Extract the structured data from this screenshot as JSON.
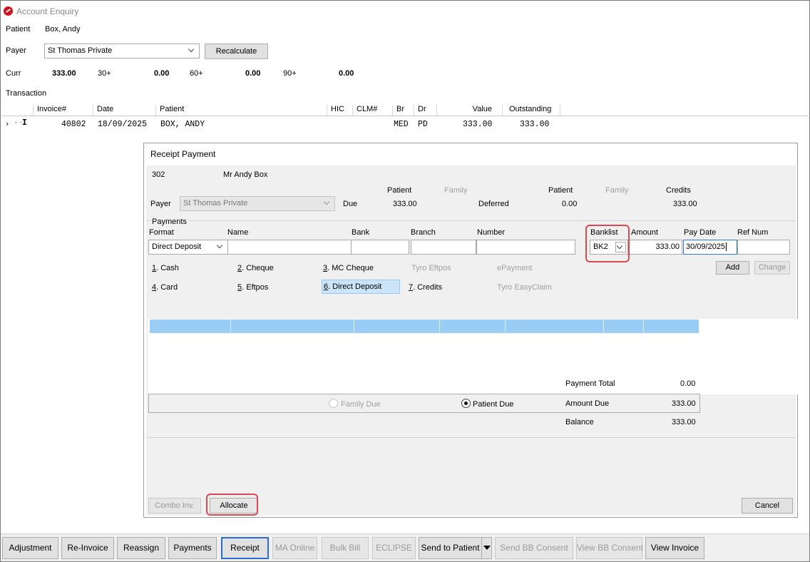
{
  "window": {
    "title": "Account Enquiry"
  },
  "enquiry": {
    "patient_label": "Patient",
    "patient_value": "Box, Andy",
    "payer_label": "Payer",
    "payer_value": "St Thomas Private",
    "recalculate_label": "Recalculate",
    "curr_label": "Curr",
    "curr_value": "333.00",
    "b30_label": "30+",
    "b30_value": "0.00",
    "b60_label": "60+",
    "b60_value": "0.00",
    "b90_label": "90+",
    "b90_value": "0.00",
    "transaction_label": "Transaction"
  },
  "grid": {
    "headers": [
      "Invoice#",
      "Date",
      "Patient",
      "HIC",
      "CLM#",
      "Br",
      "Dr",
      "Value",
      "Outstanding"
    ],
    "rows": [
      {
        "invoice": "40802",
        "date": "18/09/2025",
        "patient": "BOX, ANDY",
        "br": "MED",
        "dr": "PD",
        "value": "333.00",
        "outstanding": "333.00"
      }
    ]
  },
  "receipt": {
    "title": "Receipt Payment",
    "patient_id": "302",
    "patient_name": "Mr Andy Box",
    "hdr_patient": "Patient",
    "hdr_family": "Family",
    "hdr_patient2": "Patient",
    "hdr_family2": "Family",
    "hdr_credits": "Credits",
    "payer_label": "Payer",
    "payer_value": "St Thomas Private",
    "due_label": "Due",
    "due_value": "333.00",
    "deferred_label": "Deferred",
    "deferred_value": "0.00",
    "credits_value": "333.00",
    "payments_label": "Payments",
    "col_format": "Format",
    "col_name": "Name",
    "col_bank": "Bank",
    "col_branch": "Branch",
    "col_number": "Number",
    "col_banklist": "Banklist",
    "col_amount": "Amount",
    "col_paydate": "Pay Date",
    "col_refnum": "Ref Num",
    "format_value": "Direct Deposit",
    "name_value": "",
    "bank_value": "",
    "branch_value": "",
    "number_value": "",
    "banklist_value": "BK2",
    "amount_value": "333.00",
    "paydate_value": "30/09/2025",
    "refnum_value": "",
    "add_label": "Add",
    "change_label": "Change",
    "options": {
      "cash": {
        "key": "1",
        "rest": ". Cash"
      },
      "cheque": {
        "key": "2",
        "rest": ". Cheque"
      },
      "mc_cheque": {
        "key": "3",
        "rest": ". MC Cheque"
      },
      "tyro_eftpos": "Tyro Eftpos",
      "epayment": "ePayment",
      "card": {
        "key": "4",
        "rest": ". Card"
      },
      "eftpos": {
        "key": "5",
        "rest": ". Eftpos"
      },
      "direct_deposit": {
        "key": "6",
        "rest": ". Direct Deposit"
      },
      "credits": {
        "key": "7",
        "rest": ". Credits"
      },
      "tyro_easyclaim": "Tyro EasyClaim"
    },
    "payment_total_label": "Payment Total",
    "payment_total_value": "0.00",
    "family_due_label": "Family Due",
    "patient_due_label": "Patient Due",
    "amount_due_label": "Amount Due",
    "amount_due_value": "333.00",
    "balance_label": "Balance",
    "balance_value": "333.00",
    "combo_inv_label": "Combo Inv.",
    "allocate_label": "Allocate",
    "cancel_label": "Cancel"
  },
  "toolbar": {
    "adjustment": "Adjustment",
    "reinvoice": "Re-Invoice",
    "reassign": "Reassign",
    "payments": "Payments",
    "receipt": "Receipt",
    "ma_online": "MA Online",
    "bulk_bill": "Bulk Bill",
    "eclipse": "ECLIPSE",
    "send_to_patient": "Send to Patient",
    "send_bb_consent": "Send BB Consent",
    "view_bb_consent": "View BB Consent",
    "view_invoice": "View Invoice"
  }
}
